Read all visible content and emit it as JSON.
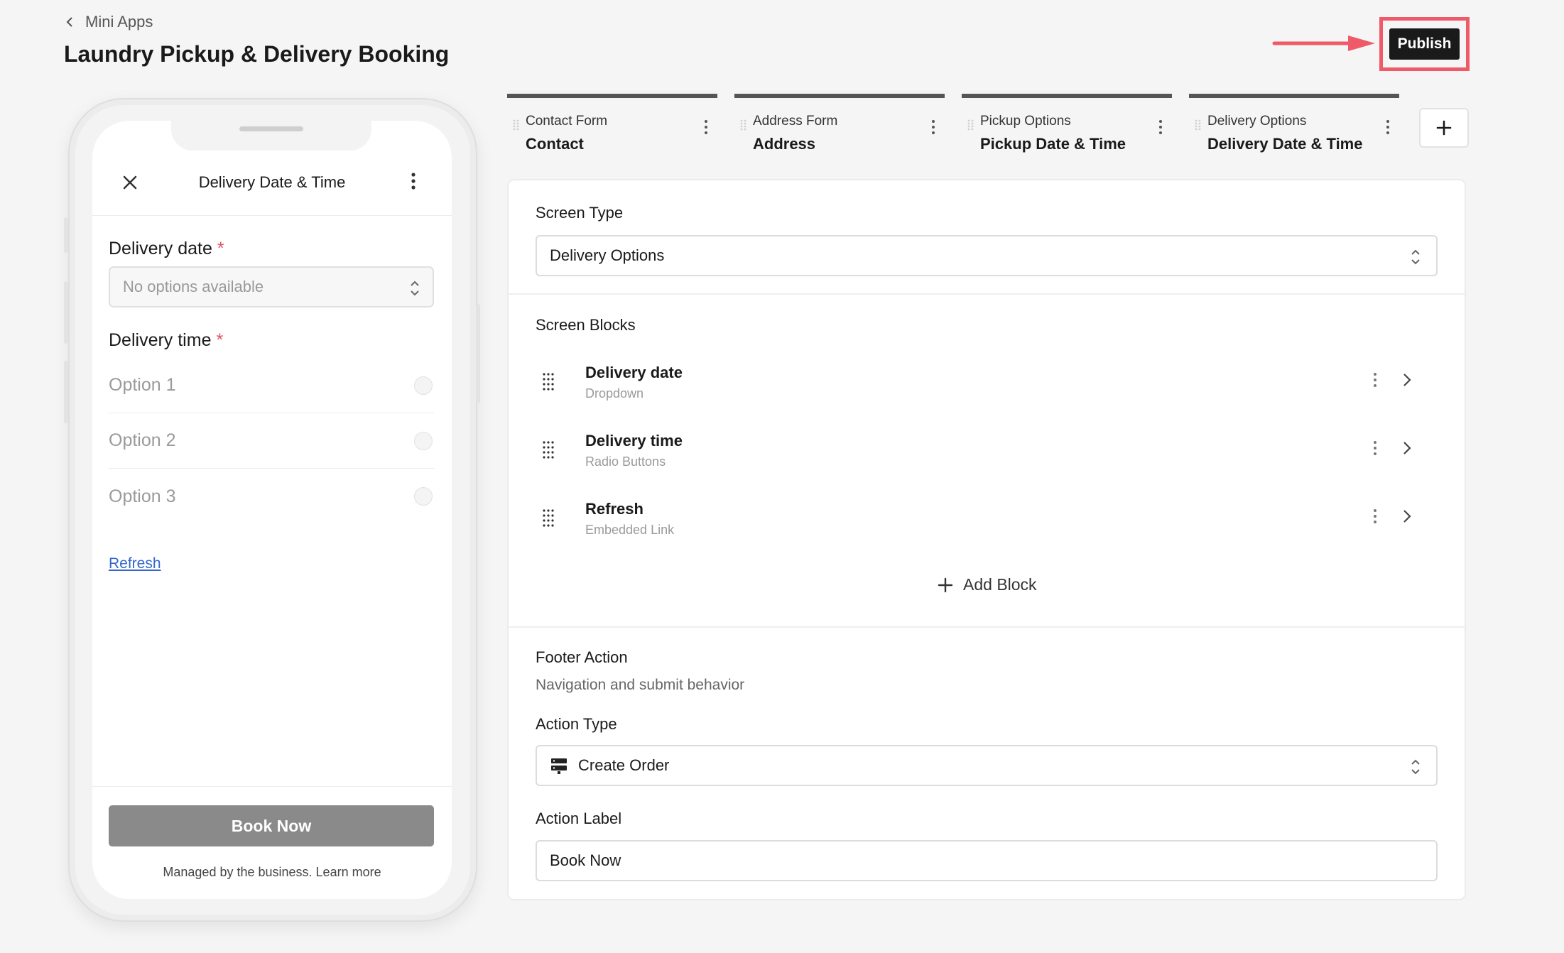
{
  "header": {
    "breadcrumb": "Mini Apps",
    "title": "Laundry Pickup & Delivery Booking",
    "publish_label": "Publish"
  },
  "phone": {
    "title": "Delivery Date & Time",
    "delivery_date_label": "Delivery date",
    "required_mark": "*",
    "delivery_date_placeholder": "No options available",
    "delivery_time_label": "Delivery time",
    "options": [
      "Option 1",
      "Option 2",
      "Option 3"
    ],
    "refresh_link": "Refresh",
    "book_button": "Book Now",
    "managed_text": "Managed by the business.",
    "learn_more": "Learn more"
  },
  "tabs": [
    {
      "kicker": "Contact Form",
      "name": "Contact"
    },
    {
      "kicker": "Address Form",
      "name": "Address"
    },
    {
      "kicker": "Pickup Options",
      "name": "Pickup Date & Time"
    },
    {
      "kicker": "Delivery Options",
      "name": "Delivery Date & Time"
    }
  ],
  "panel": {
    "screen_type_label": "Screen Type",
    "screen_type_value": "Delivery Options",
    "screen_blocks_label": "Screen Blocks",
    "blocks": [
      {
        "name": "Delivery date",
        "type": "Dropdown"
      },
      {
        "name": "Delivery time",
        "type": "Radio Buttons"
      },
      {
        "name": "Refresh",
        "type": "Embedded Link"
      }
    ],
    "add_block_label": "Add Block",
    "footer_action_label": "Footer Action",
    "footer_action_sub": "Navigation and submit behavior",
    "action_type_label": "Action Type",
    "action_type_value": "Create Order",
    "action_label_label": "Action Label",
    "action_label_value": "Book Now"
  },
  "colors": {
    "accent_highlight": "#ee5a68",
    "publish_bg": "#1a1a1a",
    "link": "#3366cc"
  }
}
